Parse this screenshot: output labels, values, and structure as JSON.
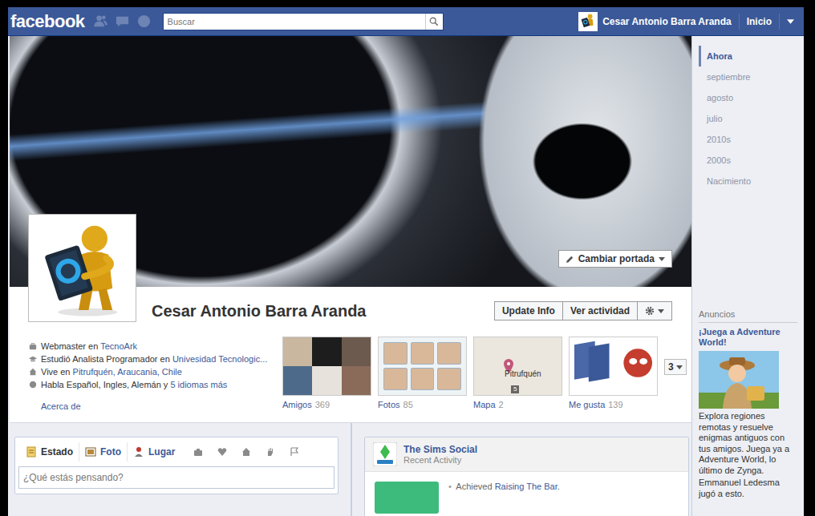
{
  "topbar": {
    "logo": "facebook",
    "search": {
      "placeholder": "Buscar"
    },
    "user": "Cesar Antonio Barra Aranda",
    "home": "Inicio"
  },
  "cover": {
    "change_button": "Cambiar portada"
  },
  "profile": {
    "name": "Cesar Antonio Barra Aranda",
    "buttons": [
      "Update Info",
      "Ver actividad"
    ]
  },
  "info": [
    {
      "kind": "work",
      "text": "Webmaster en",
      "link": "TecnoArk"
    },
    {
      "kind": "study",
      "text": "Estudió Analista Programador en",
      "link": "Univesidad Tecnologic..."
    },
    {
      "kind": "home",
      "text": "Vive en",
      "link": "Pitrufquén, Araucania, Chile"
    },
    {
      "kind": "language",
      "text": "Habla Español, Ingles, Alemán y",
      "link": "5 idiomas más"
    }
  ],
  "about_link": "Acerca de",
  "sections": [
    {
      "kind": "friends",
      "label": "Amigos",
      "count": "369"
    },
    {
      "kind": "photos",
      "label": "Fotos",
      "count": "85"
    },
    {
      "kind": "map",
      "label": "Mapa",
      "count": "2",
      "place": "Pitrufquén",
      "badge": "5"
    },
    {
      "kind": "likes",
      "label": "Me gusta",
      "count": "139"
    }
  ],
  "more_sections": "3",
  "composer": {
    "tabs": [
      {
        "kind": "status",
        "label": "Estado",
        "selected": true
      },
      {
        "kind": "photo",
        "label": "Foto",
        "selected": false
      },
      {
        "kind": "place",
        "label": "Lugar",
        "selected": false
      }
    ],
    "placeholder": "¿Qué estás pensando?"
  },
  "activity": {
    "app": "The Sims Social",
    "subtitle": "Recent Activity",
    "items": [
      {
        "bullet": "•",
        "text": "Achieved",
        "link": "Raising The Bar",
        "end": "."
      }
    ]
  },
  "timeline_nav": [
    {
      "label": "Ahora",
      "selected": true
    },
    {
      "label": "septiembre",
      "selected": false
    },
    {
      "label": "agosto",
      "selected": false
    },
    {
      "label": "julio",
      "selected": false
    },
    {
      "label": "2010s",
      "selected": false
    },
    {
      "label": "2000s",
      "selected": false
    },
    {
      "label": "Nacimiento",
      "selected": false
    }
  ],
  "ads": {
    "header": "Anuncios",
    "title": "¡Juega a Adventure World!",
    "body": "Explora regiones remotas y resuelve enigmas antiguos con tus amigos. Juega ya a Adventure World, lo último de Zynga.",
    "social": "Emmanuel Ledesma jugó a esto."
  }
}
